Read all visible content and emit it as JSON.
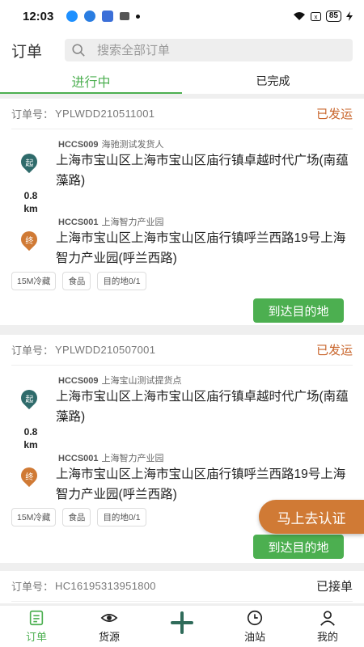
{
  "status_bar": {
    "time": "12:03",
    "battery": "85"
  },
  "header": {
    "title": "订单",
    "search_placeholder": "搜索全部订单"
  },
  "tabs": [
    {
      "label": "进行中",
      "active": true
    },
    {
      "label": "已完成",
      "active": false
    }
  ],
  "order_label": "订单号：",
  "orders": [
    {
      "order_no": "YPLWDD210511001",
      "status": "已发运",
      "start": {
        "code": "HCCS009",
        "name": "海驰测试发货人",
        "address": "上海市宝山区上海市宝山区庙行镇卓越时代广场(南蕴藻路)",
        "marker": "起"
      },
      "distance_value": "0.8",
      "distance_unit": "km",
      "end": {
        "code": "HCCS001",
        "name": "上海智力产业园",
        "address": "上海市宝山区上海市宝山区庙行镇呼兰西路19号上海智力产业园(呼兰西路)",
        "marker": "终"
      },
      "tags": [
        "15M冷藏",
        "食品",
        "目的地0/1"
      ],
      "action": "到达目的地"
    },
    {
      "order_no": "YPLWDD210507001",
      "status": "已发运",
      "start": {
        "code": "HCCS009",
        "name": "上海宝山测试提货点",
        "address": "上海市宝山区上海市宝山区庙行镇卓越时代广场(南蕴藻路)",
        "marker": "起"
      },
      "distance_value": "0.8",
      "distance_unit": "km",
      "end": {
        "code": "HCCS001",
        "name": "上海智力产业园",
        "address": "上海市宝山区上海市宝山区庙行镇呼兰西路19号上海智力产业园(呼兰西路)",
        "marker": "终"
      },
      "tags": [
        "15M冷藏",
        "食品",
        "目的地0/1"
      ],
      "action": "到达目的地"
    },
    {
      "order_no": "HC16195313951800",
      "status": "已接单"
    }
  ],
  "float_button": "马上去认证",
  "bottom_nav": [
    {
      "label": "订单",
      "icon": "order-list-icon",
      "active": true
    },
    {
      "label": "货源",
      "icon": "eye-icon",
      "active": false
    },
    {
      "label": "",
      "icon": "plus-icon",
      "active": false
    },
    {
      "label": "油站",
      "icon": "clock-icon",
      "active": false
    },
    {
      "label": "我的",
      "icon": "user-icon",
      "active": false
    }
  ],
  "colors": {
    "primary": "#4caf50",
    "status": "#c8642a",
    "start_pin": "#2f6b6b",
    "end_pin": "#d07a35"
  }
}
